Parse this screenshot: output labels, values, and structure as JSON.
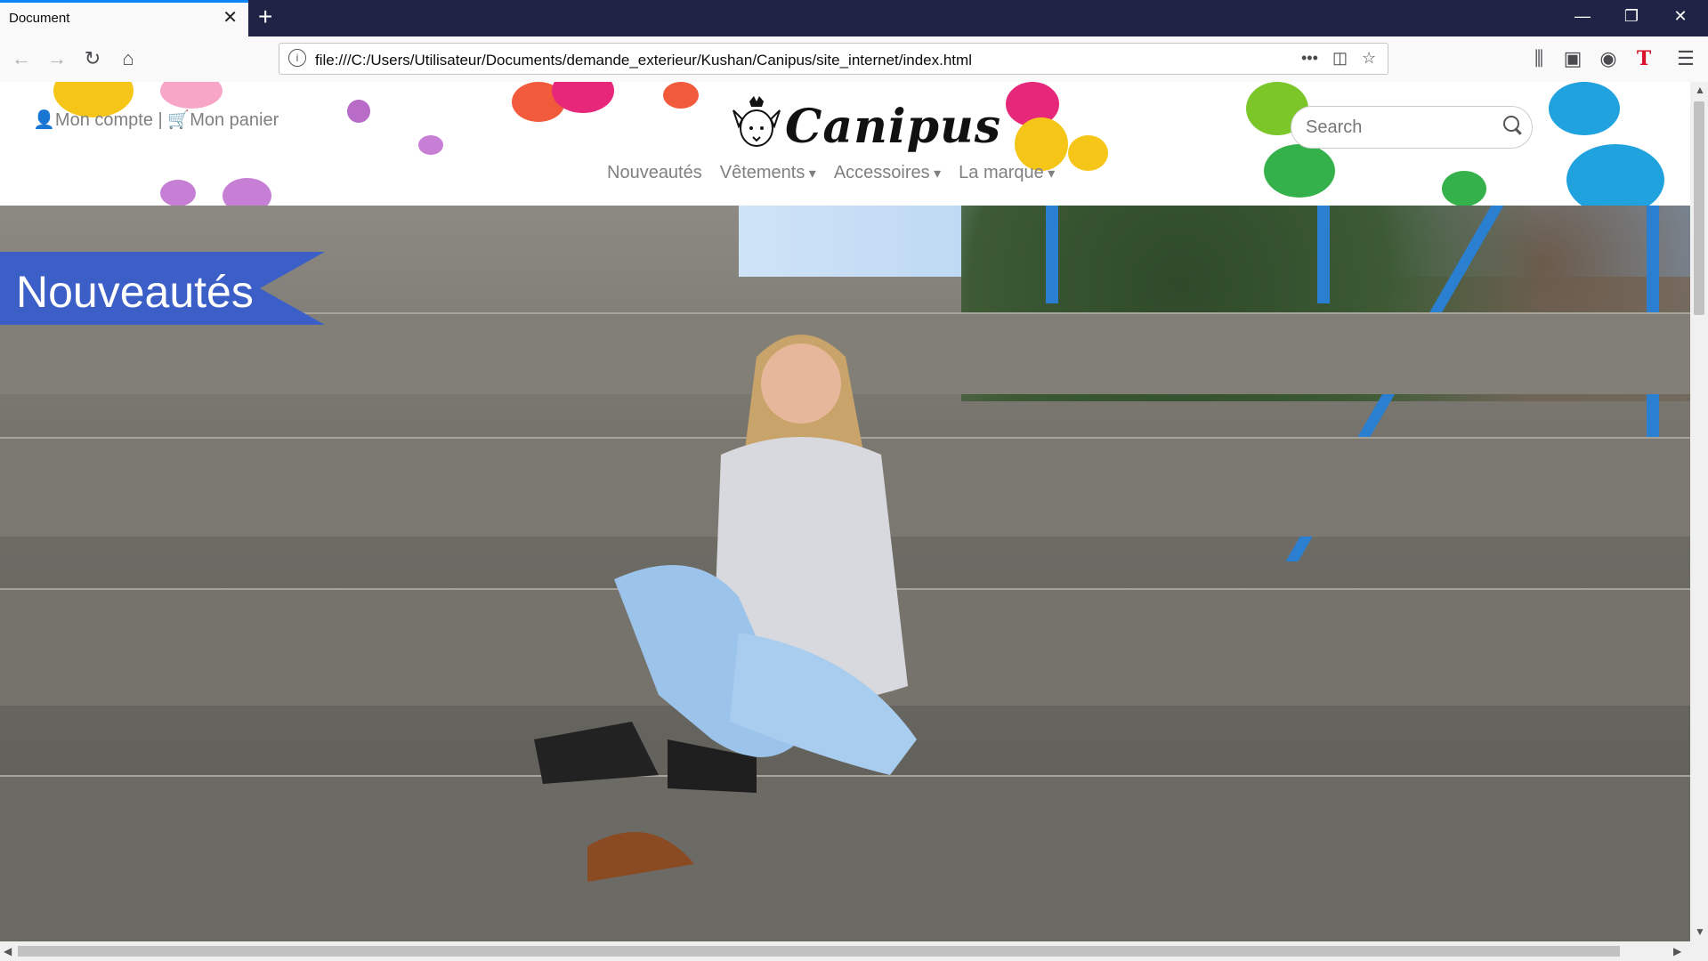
{
  "browser": {
    "tab_title": "Document",
    "tab_close": "✕",
    "new_tab": "+",
    "window_controls": {
      "minimize": "—",
      "restore": "❐",
      "close": "✕"
    },
    "url": "file:///C:/Users/Utilisateur/Documents/demande_exterieur/Kushan/Canipus/site_internet/index.html",
    "nav_icons": [
      "back-icon",
      "forward-icon",
      "reload-icon",
      "home-icon"
    ],
    "toolbar_icons": [
      "library-icon",
      "sidebar-icon",
      "account-icon",
      "extension-t-icon",
      "menu-icon"
    ]
  },
  "site": {
    "account_label": "Mon compte",
    "separator": "|",
    "cart_label": "Mon panier",
    "logo_text": "Canipus",
    "search_placeholder": "Search",
    "menu": [
      {
        "label": "Nouveautés",
        "dropdown": false
      },
      {
        "label": "Vêtements",
        "dropdown": true
      },
      {
        "label": "Accessoires",
        "dropdown": true
      },
      {
        "label": "La marque",
        "dropdown": true
      }
    ],
    "banner_title": "Nouveautés",
    "accent_color": "#3c5ec7"
  }
}
